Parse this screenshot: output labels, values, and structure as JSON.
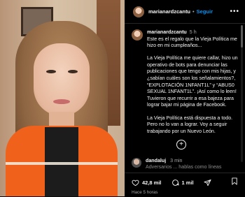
{
  "post": {
    "username": "marianardzcantu",
    "follow_label": "Seguir",
    "separator": "•",
    "more_label": "•••"
  },
  "caption": {
    "username": "marianardzcantu",
    "time": "5 h",
    "paragraphs": [
      "Este es el regalo que la Vieja Política me hizo en mi cumpleaños...",
      "La Vieja Política me quiere callar,  hizo un operativo de bots para denunciar las publicaciones que tengo con mis hijas, y ¿sabían cuáles son los señalamientos?, “EXPLOTACIÓN 1NFANT1L” y “ABUS0 SEXUAL 1NFANT1L”. ¡Así como lo leen! Tuvieron que recurrir a esa bajeza para lograr bajar mi página de Facebook.",
      "La Vieja Política está dispuesta a todo. Pero no lo van a lograr. Voy a seguir trabajando por un Nuevo León."
    ]
  },
  "add_button_label": "+",
  "comment": {
    "username": "dandaluj",
    "time": "3 min",
    "text_preview": "Adversarios ... hablas como líneas"
  },
  "actions": {
    "likes": "42,8 mil",
    "comments": "1 mil",
    "posted_ago": "Hace 5 horas"
  },
  "colors": {
    "accent": "#0095f6",
    "background": "#000000"
  }
}
